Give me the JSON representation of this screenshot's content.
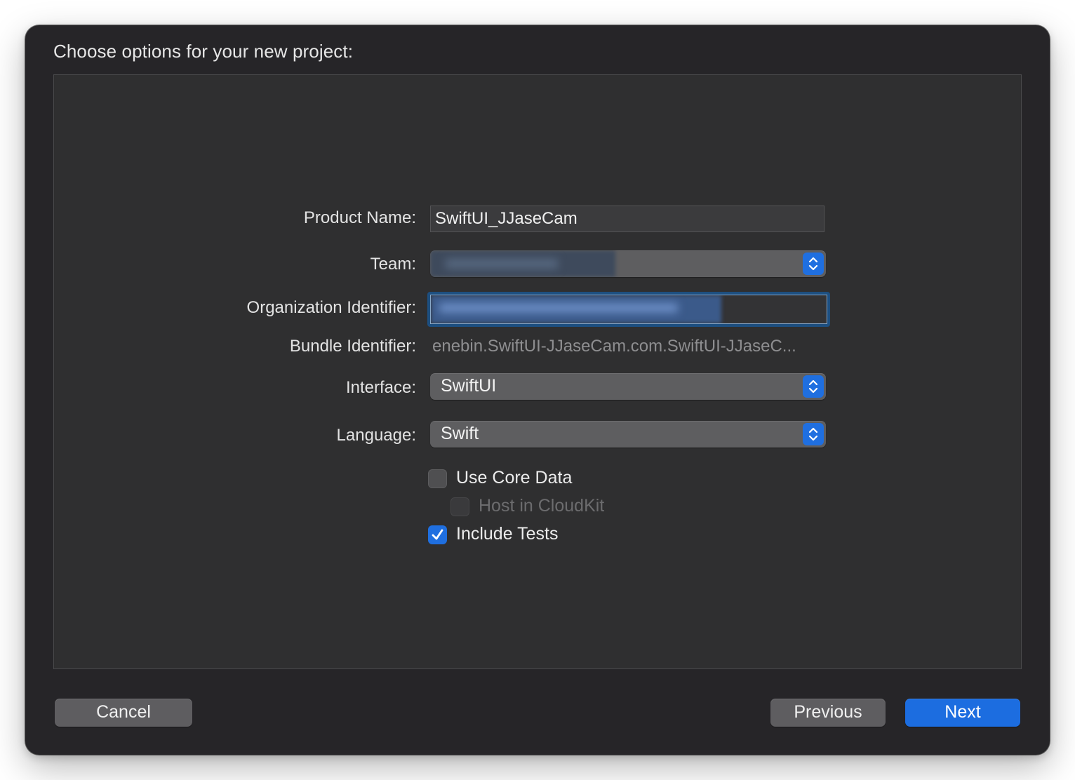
{
  "dialog": {
    "heading": "Choose options for your new project:"
  },
  "form": {
    "product_name": {
      "label": "Product Name:",
      "value": "SwiftUI_JJaseCam"
    },
    "team": {
      "label": "Team:",
      "value": ""
    },
    "organization_identifier": {
      "label": "Organization Identifier:",
      "value": ""
    },
    "bundle_identifier": {
      "label": "Bundle Identifier:",
      "value": "enebin.SwiftUI-JJaseCam.com.SwiftUI-JJaseC..."
    },
    "interface": {
      "label": "Interface:",
      "value": "SwiftUI"
    },
    "language": {
      "label": "Language:",
      "value": "Swift"
    },
    "use_core_data": {
      "label": "Use Core Data",
      "checked": false
    },
    "host_in_cloudkit": {
      "label": "Host in CloudKit",
      "checked": false,
      "enabled": false
    },
    "include_tests": {
      "label": "Include Tests",
      "checked": true
    }
  },
  "buttons": {
    "cancel": "Cancel",
    "previous": "Previous",
    "next": "Next"
  },
  "colors": {
    "accent": "#1f6fe0",
    "window_bg": "#262528",
    "panel_bg": "#2f2f30"
  }
}
